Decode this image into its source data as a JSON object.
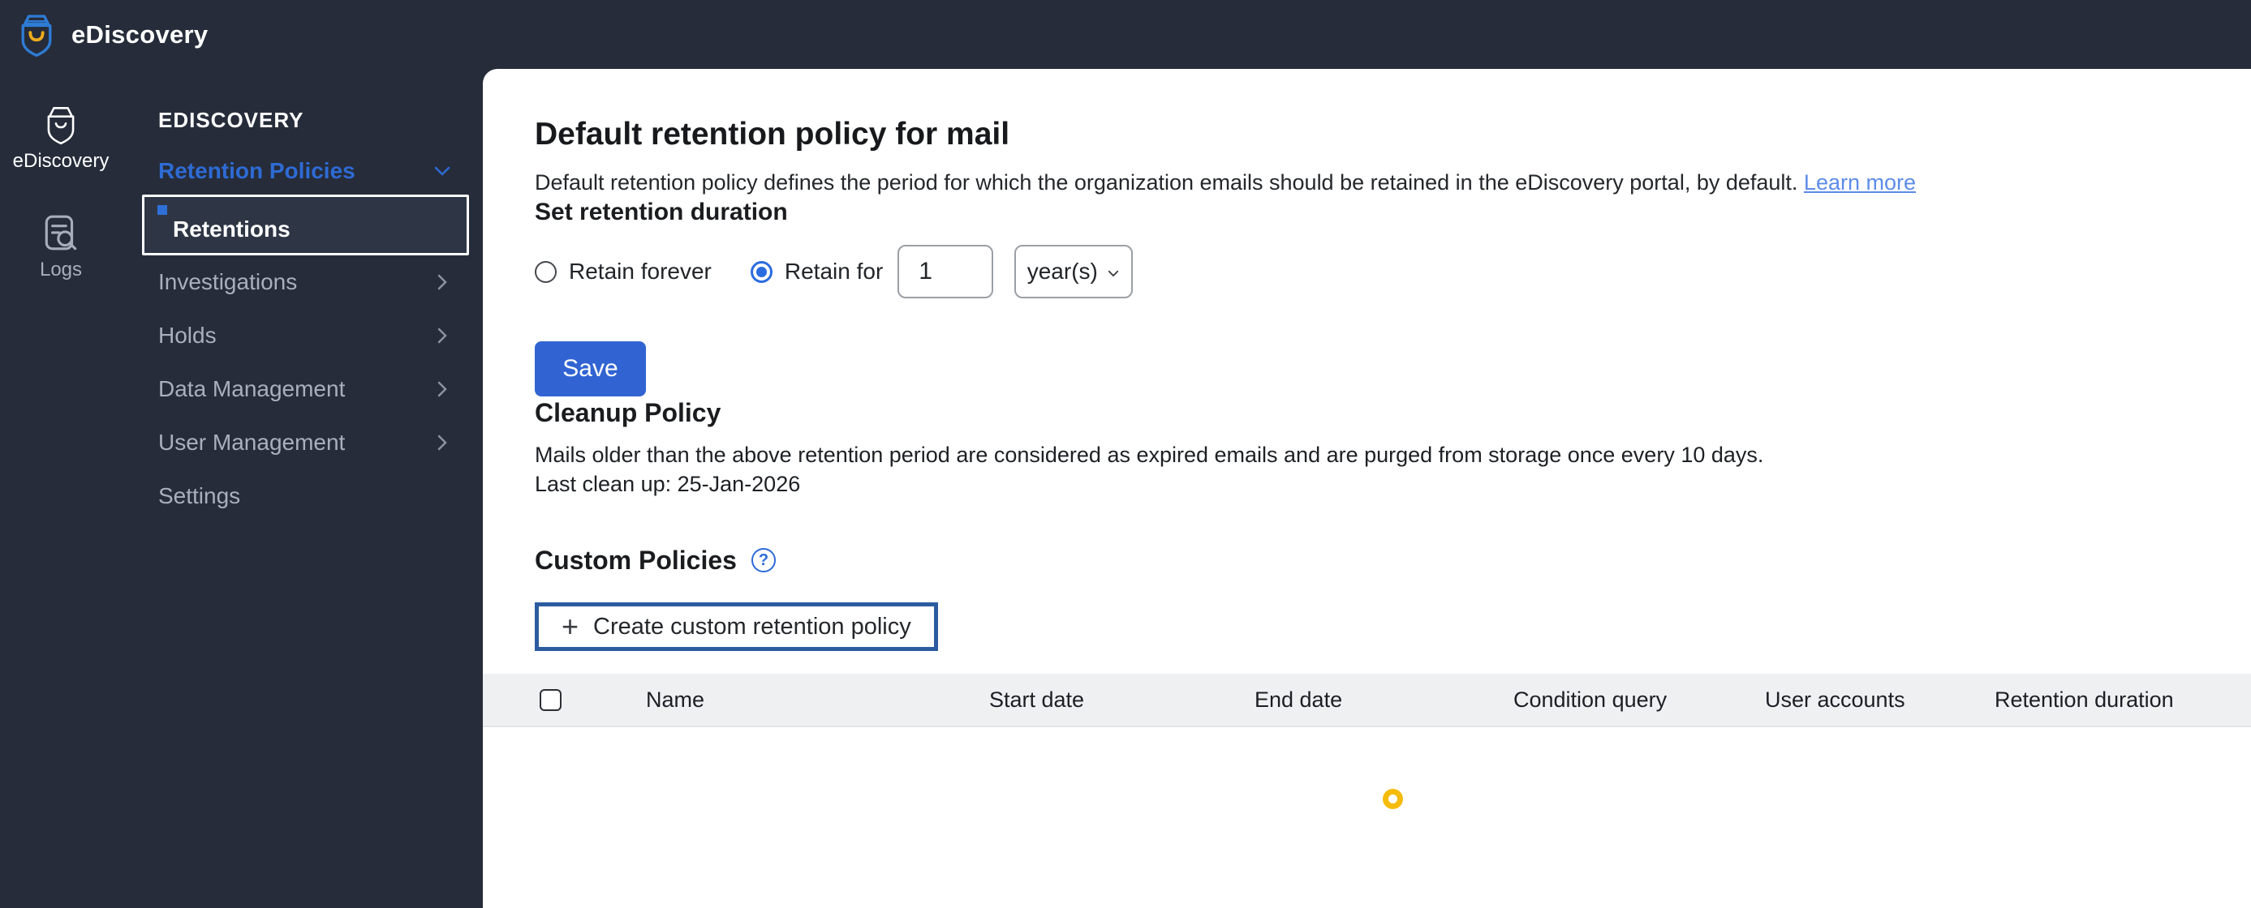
{
  "topbar": {
    "app_title": "eDiscovery"
  },
  "rail": {
    "items": [
      {
        "label": "eDiscovery",
        "active": true
      },
      {
        "label": "Logs",
        "active": false
      }
    ]
  },
  "sidebar": {
    "section_title": "EDISCOVERY",
    "items": [
      {
        "label": "Retention Policies",
        "state": "expanded",
        "chevron": "down"
      },
      {
        "label": "Retentions",
        "selected": true
      },
      {
        "label": "Investigations",
        "chevron": "right"
      },
      {
        "label": "Holds",
        "chevron": "right"
      },
      {
        "label": "Data Management",
        "chevron": "right"
      },
      {
        "label": "User Management",
        "chevron": "right"
      },
      {
        "label": "Settings"
      }
    ]
  },
  "main": {
    "title": "Default retention policy for mail",
    "description": "Default retention policy defines the period for which the organization emails should be retained in the eDiscovery portal, by default.",
    "learn_more": "Learn more",
    "retention": {
      "heading": "Set retention duration",
      "radio_forever": "Retain forever",
      "radio_for": "Retain for",
      "radio_selected": "Retain for",
      "duration_value": "1",
      "duration_unit": "year(s)",
      "save_label": "Save"
    },
    "cleanup": {
      "heading": "Cleanup Policy",
      "line1": "Mails older than the above retention period are considered as expired emails and are purged from storage once every 10 days.",
      "line2": "Last clean up: 25-Jan-2026"
    },
    "custom": {
      "heading": "Custom Policies",
      "help_glyph": "?",
      "plus_glyph": "+",
      "create_label": "Create custom retention policy"
    },
    "table": {
      "columns": [
        "Name",
        "Start date",
        "End date",
        "Condition query",
        "User accounts",
        "Retention duration"
      ]
    },
    "loading": true
  },
  "colors": {
    "shell_bg": "#262c3a",
    "accent_blue": "#2e6bd4",
    "save_blue": "#3164d2",
    "link_blue": "#5c8ce8",
    "highlight_border": "#2b5c9f",
    "selected_outline": "#ffffff",
    "spinner_yellow": "#f5bc0c",
    "table_header_bg": "#eef0f2"
  }
}
